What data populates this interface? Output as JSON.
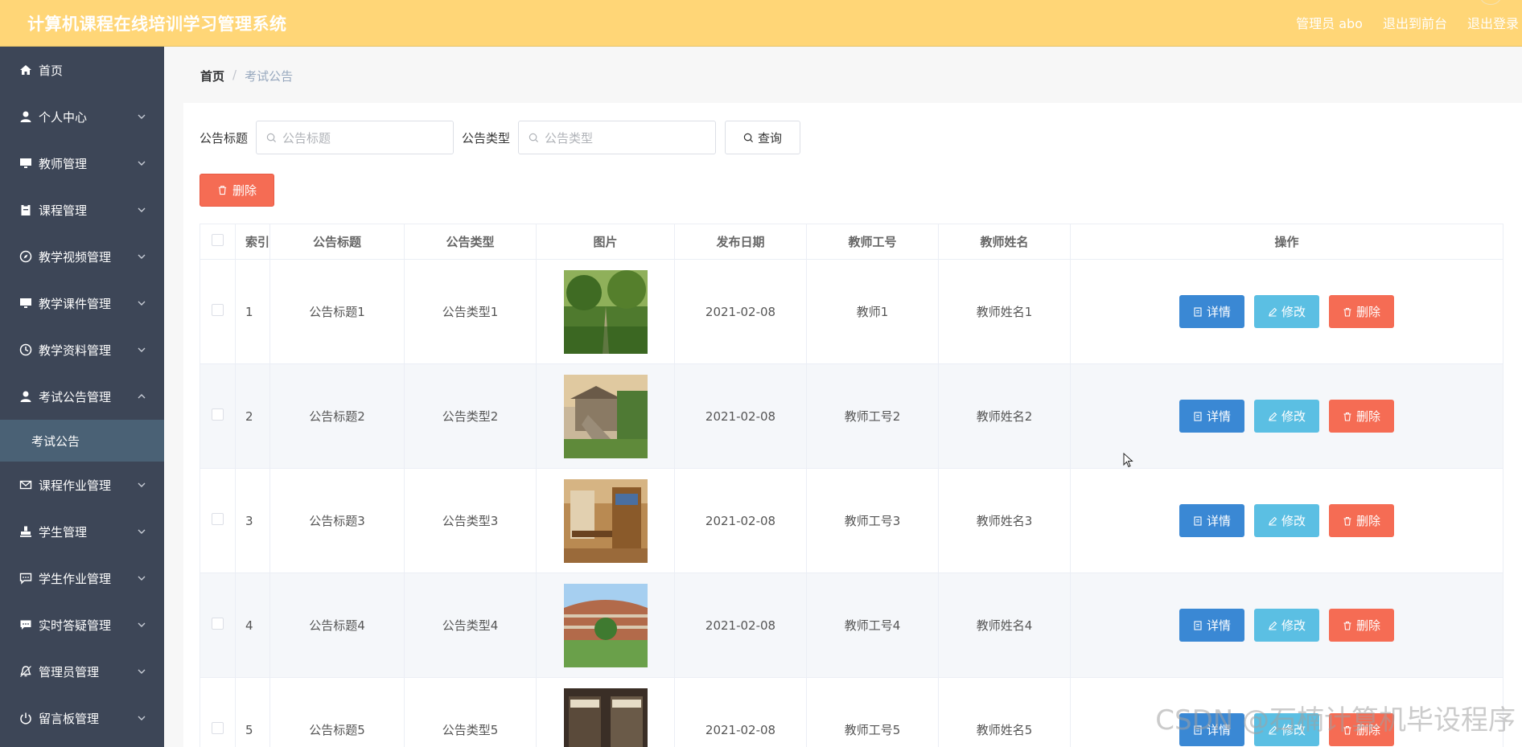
{
  "header": {
    "title": "计算机课程在线培训学习管理系统",
    "user": "管理员 abo",
    "to_front": "退出到前台",
    "logout": "退出登录"
  },
  "sidebar": {
    "items": [
      {
        "label": "首页",
        "icon": "home-icon"
      },
      {
        "label": "个人中心",
        "icon": "user-icon"
      },
      {
        "label": "教师管理",
        "icon": "monitor-icon"
      },
      {
        "label": "课程管理",
        "icon": "clipboard-icon"
      },
      {
        "label": "教学视频管理",
        "icon": "compass-icon"
      },
      {
        "label": "教学课件管理",
        "icon": "monitor-icon"
      },
      {
        "label": "教学资料管理",
        "icon": "clock-icon"
      },
      {
        "label": "考试公告管理",
        "icon": "user-icon"
      },
      {
        "label": "课程作业管理",
        "icon": "mail-icon"
      },
      {
        "label": "学生管理",
        "icon": "stamp-icon"
      },
      {
        "label": "学生作业管理",
        "icon": "chat-icon"
      },
      {
        "label": "实时答疑管理",
        "icon": "chat-icon"
      },
      {
        "label": "管理员管理",
        "icon": "bell-icon"
      },
      {
        "label": "留言板管理",
        "icon": "power-icon"
      }
    ],
    "active_sub": "考试公告"
  },
  "breadcrumb": {
    "home": "首页",
    "sep": "/",
    "current": "考试公告"
  },
  "search": {
    "title_label": "公告标题",
    "title_placeholder": "公告标题",
    "type_label": "公告类型",
    "type_placeholder": "公告类型",
    "query_label": "查询"
  },
  "toolbar": {
    "delete_label": "删除"
  },
  "table": {
    "headers": [
      "索引",
      "公告标题",
      "公告类型",
      "图片",
      "发布日期",
      "教师工号",
      "教师姓名",
      "操作"
    ],
    "rows": [
      {
        "index": "1",
        "title": "公告标题1",
        "type": "公告类型1",
        "date": "2021-02-08",
        "teacher_id": "教师1",
        "teacher_name": "教师姓名1"
      },
      {
        "index": "2",
        "title": "公告标题2",
        "type": "公告类型2",
        "date": "2021-02-08",
        "teacher_id": "教师工号2",
        "teacher_name": "教师姓名2"
      },
      {
        "index": "3",
        "title": "公告标题3",
        "type": "公告类型3",
        "date": "2021-02-08",
        "teacher_id": "教师工号3",
        "teacher_name": "教师姓名3"
      },
      {
        "index": "4",
        "title": "公告标题4",
        "type": "公告类型4",
        "date": "2021-02-08",
        "teacher_id": "教师工号4",
        "teacher_name": "教师姓名4"
      },
      {
        "index": "5",
        "title": "公告标题5",
        "type": "公告类型5",
        "date": "2021-02-08",
        "teacher_id": "教师工号5",
        "teacher_name": "教师姓名5"
      }
    ],
    "actions": {
      "detail": "详情",
      "edit": "修改",
      "delete": "删除"
    }
  },
  "watermark": "CSDN @石楠计算机毕设程序",
  "colors": {
    "header": "#ffd677",
    "sidebar": "#3d4657",
    "sidebar_active": "#4a6175",
    "detail": "#3a88d4",
    "edit": "#5bbfe3",
    "delete": "#f56c54"
  }
}
